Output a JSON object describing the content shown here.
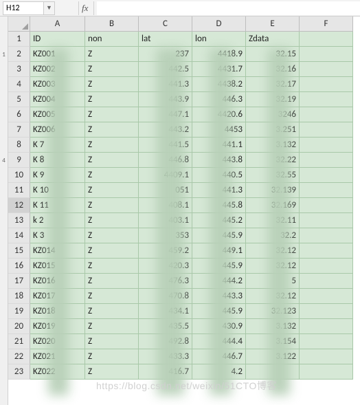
{
  "formula_bar": {
    "cell_ref": "H12",
    "fx_label": "fx",
    "value": ""
  },
  "columns": [
    "A",
    "B",
    "C",
    "D",
    "E",
    "F"
  ],
  "headers": {
    "A": "ID",
    "B": "non",
    "C": "lat",
    "D": "lon",
    "E": "Zdata",
    "F": ""
  },
  "rows": [
    {
      "r": 2,
      "A": "KZ001",
      "B": "Z",
      "C": "237",
      "D": "4418.9",
      "E": "32.15",
      "F": ""
    },
    {
      "r": 3,
      "A": "KZ002",
      "B": "Z",
      "C": "442.5",
      "D": "4431.7",
      "E": "32.16",
      "F": ""
    },
    {
      "r": 4,
      "A": "KZ003",
      "B": "Z",
      "C": "441.3",
      "D": "4438.2",
      "E": "32.17",
      "F": ""
    },
    {
      "r": 5,
      "A": "KZ004",
      "B": "Z",
      "C": "443.9",
      "D": "446.3",
      "E": "32.19",
      "F": ""
    },
    {
      "r": 6,
      "A": "KZ005",
      "B": "Z",
      "C": "447.1",
      "D": "4420.6",
      "E": "3246",
      "F": ""
    },
    {
      "r": 7,
      "A": "KZ006",
      "B": "Z",
      "C": "443.2",
      "D": "4453",
      "E": "3.251",
      "F": ""
    },
    {
      "r": 8,
      "A": "K  7",
      "B": "Z",
      "C": "441.5",
      "D": "441.1",
      "E": "3.132",
      "F": ""
    },
    {
      "r": 9,
      "A": "K  8",
      "B": "Z",
      "C": "446.8",
      "D": "443.8",
      "E": "32.22",
      "F": ""
    },
    {
      "r": 10,
      "A": "K  9",
      "B": "Z",
      "C": "4409.1",
      "D": "440.5",
      "E": "32.55",
      "F": ""
    },
    {
      "r": 11,
      "A": "K  10",
      "B": "Z",
      "C": "051",
      "D": "441.3",
      "E": "32.139",
      "F": ""
    },
    {
      "r": 12,
      "A": "K  11",
      "B": "Z",
      "C": "408.1",
      "D": "445.8",
      "E": "32.169",
      "F": ""
    },
    {
      "r": 13,
      "A": "k  2",
      "B": "Z",
      "C": "403.1",
      "D": "445.2",
      "E": "32.11",
      "F": ""
    },
    {
      "r": 14,
      "A": "K  3",
      "B": "Z",
      "C": "353",
      "D": "445.9",
      "E": "32.2",
      "F": ""
    },
    {
      "r": 15,
      "A": "KZ014",
      "B": "Z",
      "C": "459.2",
      "D": "449.1",
      "E": "32.12",
      "F": ""
    },
    {
      "r": 16,
      "A": "KZ015",
      "B": "Z",
      "C": "420.3",
      "D": "445.9",
      "E": "32.12",
      "F": ""
    },
    {
      "r": 17,
      "A": "KZ016",
      "B": "Z",
      "C": "476.3",
      "D": "444.2",
      "E": "5",
      "F": ""
    },
    {
      "r": 18,
      "A": "KZ017",
      "B": "Z",
      "C": "470.8",
      "D": "443.3",
      "E": "32.12",
      "F": ""
    },
    {
      "r": 19,
      "A": "KZ018",
      "B": "Z",
      "C": "434.1",
      "D": "445.9",
      "E": "32.123",
      "F": ""
    },
    {
      "r": 20,
      "A": "KZ019",
      "B": "Z",
      "C": "435.5",
      "D": "430.9",
      "E": "3.132",
      "F": ""
    },
    {
      "r": 21,
      "A": "KZ020",
      "B": "Z",
      "C": "492.8",
      "D": "444.4",
      "E": "3.154",
      "F": ""
    },
    {
      "r": 22,
      "A": "KZ021",
      "B": "Z",
      "C": "433.3",
      "D": "446.7",
      "E": "3.122",
      "F": ""
    },
    {
      "r": 23,
      "A": "KZ022",
      "B": "Z",
      "C": "416.7",
      "D": "4.2",
      "E": "",
      "F": ""
    }
  ],
  "left_rail": {
    "marker1": "1",
    "marker2": "4"
  },
  "watermark": "https://blog.csdn.net/weixin/51CTO博客"
}
